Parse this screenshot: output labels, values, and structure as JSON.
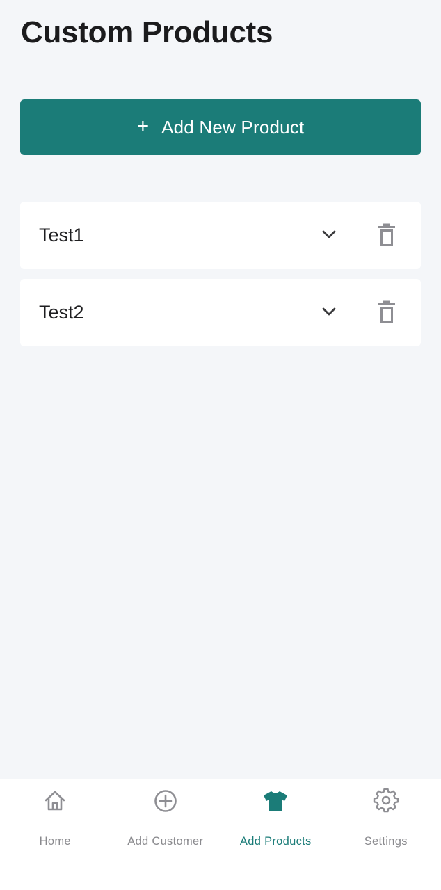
{
  "header": {
    "title": "Custom Products"
  },
  "add_button": {
    "icon": "plus-icon",
    "icon_glyph": "+",
    "label": "Add New Product"
  },
  "products": [
    {
      "name": "Test1"
    },
    {
      "name": "Test2"
    }
  ],
  "tabbar": {
    "items": [
      {
        "label": "Home",
        "icon": "home-icon",
        "active": false
      },
      {
        "label": "Add Customer",
        "icon": "plus-circle-icon",
        "active": false
      },
      {
        "label": "Add Products",
        "icon": "tshirt-icon",
        "active": true
      },
      {
        "label": "Settings",
        "icon": "gear-icon",
        "active": false
      }
    ]
  },
  "colors": {
    "accent": "#1b7c78",
    "background": "#f4f6f9",
    "card": "#ffffff",
    "inactive": "#8a8a8e"
  }
}
